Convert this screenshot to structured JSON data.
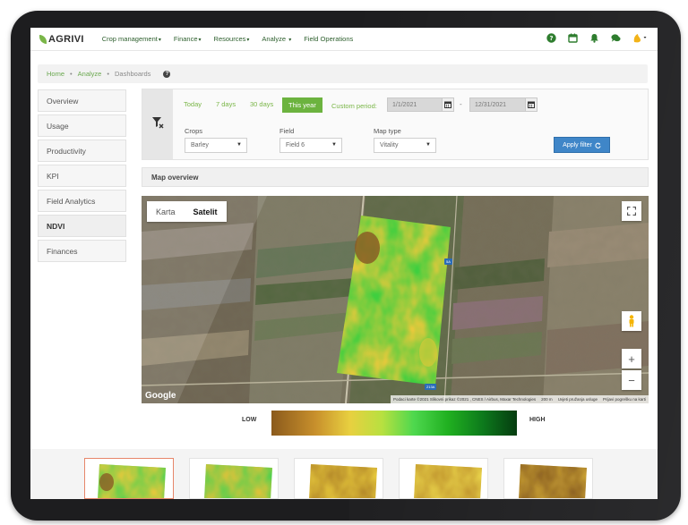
{
  "app": {
    "logo_text": "AGRIVI",
    "nav": [
      {
        "label": "Crop management",
        "caret": "▾"
      },
      {
        "label": "Finance",
        "caret": "▾"
      },
      {
        "label": "Resources",
        "caret": "▾"
      },
      {
        "label": "Analyze",
        "caret": "▾"
      },
      {
        "label": "Field Operations",
        "caret": ""
      }
    ],
    "nav_icons": [
      "help-icon",
      "calendar-icon",
      "bell-icon",
      "chat-icon",
      "user-menu-icon"
    ],
    "brand_color": "#6cb33f",
    "help_glyph": "?"
  },
  "breadcrumb": {
    "home": "Home",
    "analyze": "Analyze",
    "current": "Dashboards",
    "separator": "•"
  },
  "sidebar": {
    "items": [
      {
        "label": "Overview",
        "active": false
      },
      {
        "label": "Usage",
        "active": false
      },
      {
        "label": "Productivity",
        "active": false
      },
      {
        "label": "KPI",
        "active": false
      },
      {
        "label": "Field Analytics",
        "active": false
      },
      {
        "label": "NDVI",
        "active": true
      },
      {
        "label": "Finances",
        "active": false
      }
    ]
  },
  "filter": {
    "quick_ranges": [
      "Today",
      "7 days",
      "30 days",
      "This year"
    ],
    "selected_range": "This year",
    "custom_period_label": "Custom period:",
    "date_from": "1/1/2021",
    "date_to": "12/31/2021",
    "date_separator": "-",
    "crops_label": "Crops",
    "crops_value": "Barley",
    "field_label": "Field",
    "field_value": "Field 6",
    "map_type_label": "Map type",
    "map_type_value": "Vitality",
    "apply_label": "Apply filter",
    "apply_color": "#3f86c8"
  },
  "map": {
    "section_title": "Map overview",
    "tab_map": "Karta",
    "tab_satellite": "Satelit",
    "selected_tab": "Satelit",
    "google_label": "Google",
    "attribution": "Podaci karte ©2021 Slikovni prikaz ©2021 , CNES / Airbus, Maxar Technologies",
    "scale": "200 m",
    "terms": "Uvjeti pružanja usluge",
    "report": "Prijavi pogrešku na karti",
    "road_label_1": "5A",
    "road_label_2": "213A",
    "zoom_in": "+",
    "zoom_out": "−"
  },
  "legend": {
    "low": "LOW",
    "high": "HIGH"
  },
  "thumbnails": {
    "count": 5,
    "selected_index": 0
  }
}
